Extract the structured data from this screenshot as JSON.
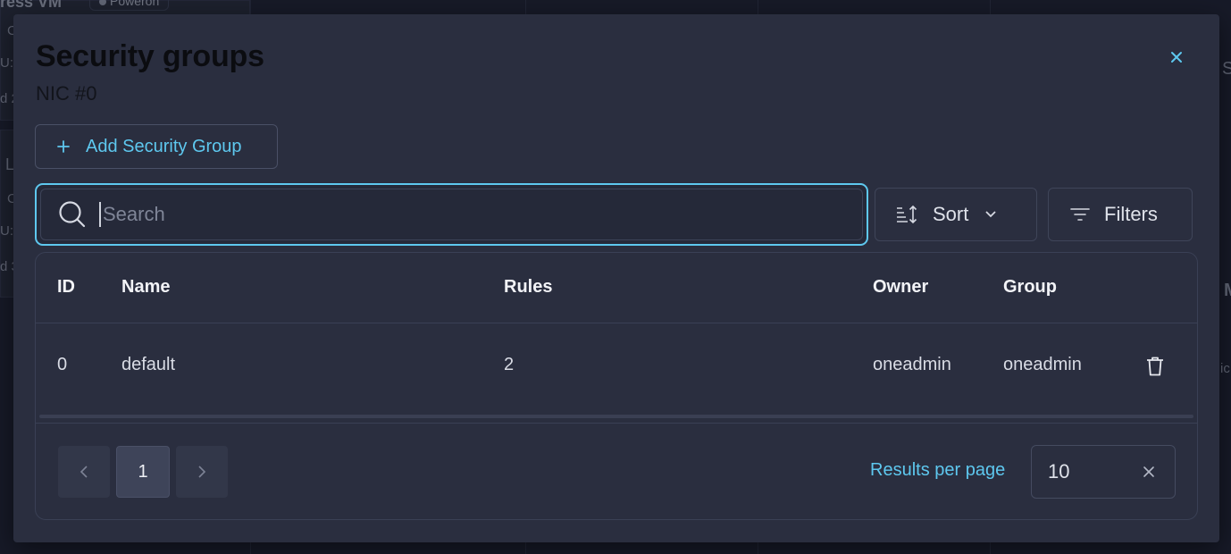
{
  "background": {
    "vm_title_fragment": "ress VM",
    "status_badge": "Poweron",
    "row_fragments": [
      "C",
      "U:",
      "d 2",
      "L",
      "C",
      "U:",
      "d 3"
    ],
    "right_fragments": [
      "S",
      "M",
      "ic"
    ]
  },
  "modal": {
    "title": "Security groups",
    "subtitle": "NIC #0",
    "close_icon": "close-icon",
    "add_button_label": "Add Security Group",
    "search_placeholder": "Search",
    "search_value": "",
    "sort_label": "Sort",
    "filters_label": "Filters",
    "accent_color": "#5ec8ef"
  },
  "table": {
    "columns": [
      "ID",
      "Name",
      "Rules",
      "Owner",
      "Group"
    ],
    "rows": [
      {
        "id": "0",
        "name": "default",
        "rules": "2",
        "owner": "oneadmin",
        "group": "oneadmin",
        "action_icon": "trash-icon"
      }
    ]
  },
  "pagination": {
    "current_page": "1",
    "results_per_page_label": "Results per page",
    "results_per_page_value": "10"
  }
}
